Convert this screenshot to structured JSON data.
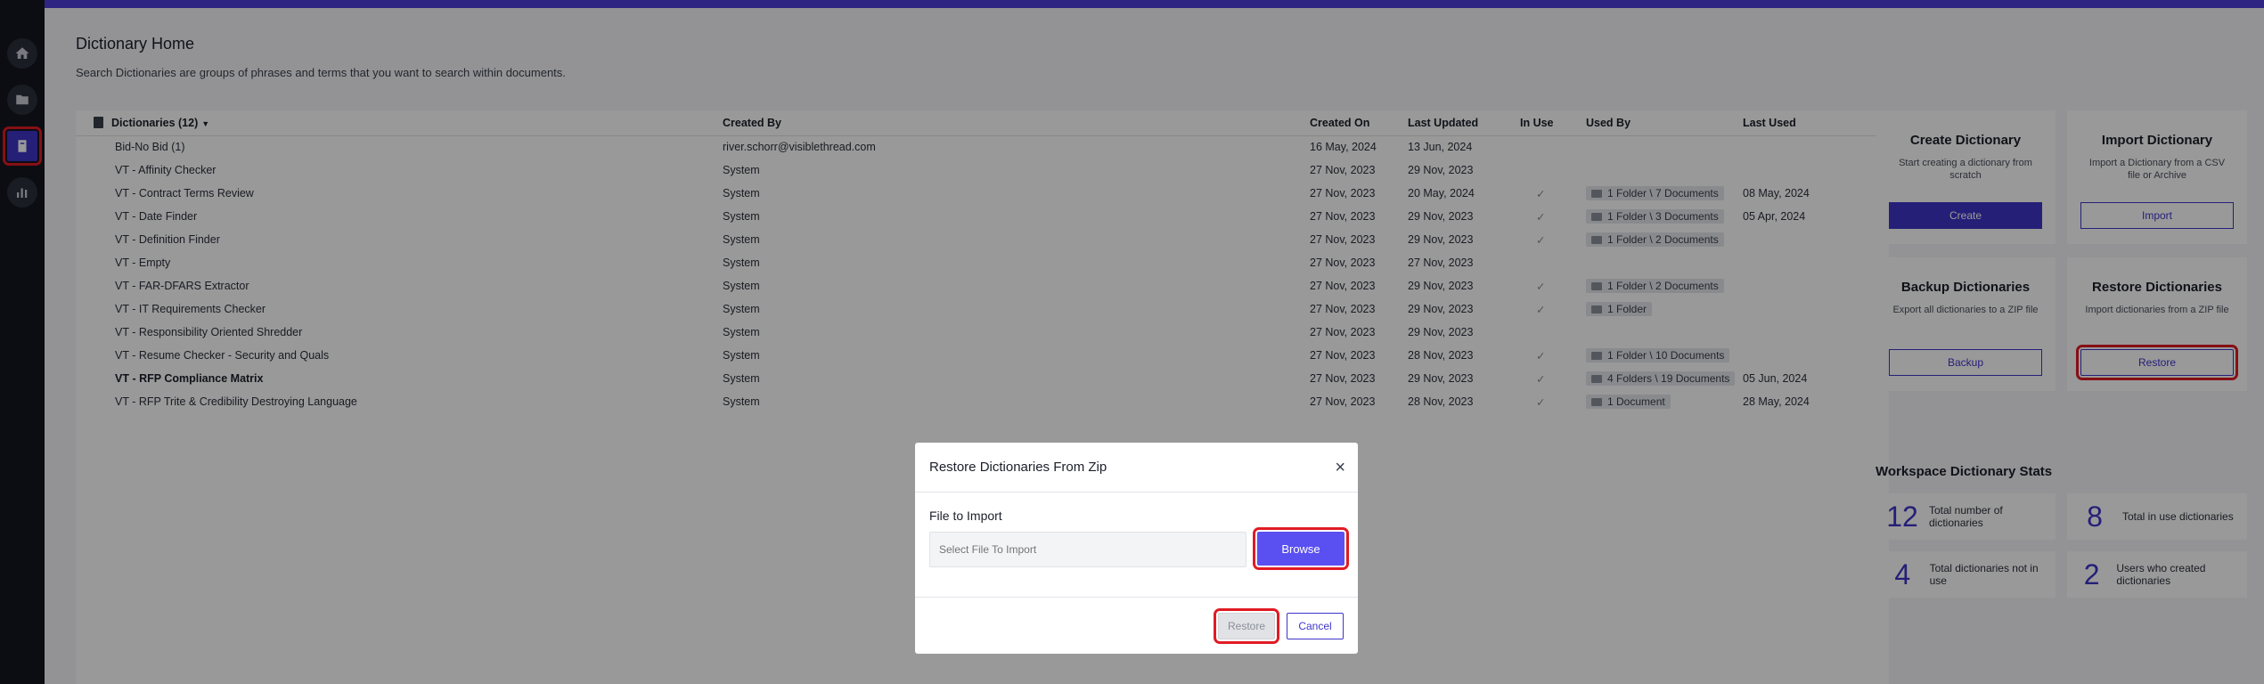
{
  "header": {
    "title": "Dictionary Home",
    "description": "Search Dictionaries are groups of phrases and terms that you want to search within documents."
  },
  "sidebar": {
    "items": [
      {
        "icon": "home-icon"
      },
      {
        "icon": "folder-icon"
      },
      {
        "icon": "dictionary-icon",
        "active": true
      },
      {
        "icon": "chart-icon"
      }
    ]
  },
  "table": {
    "columns": [
      "Dictionaries (12)",
      "Created By",
      "Created On",
      "Last Updated",
      "In Use",
      "Used By",
      "Last Used"
    ],
    "rows": [
      {
        "name": "Bid-No Bid (1)",
        "created_by": "river.schorr@visiblethread.com",
        "created_on": "16 May, 2024",
        "last_updated": "13 Jun, 2024",
        "in_use": "",
        "used_by": "",
        "last_used": ""
      },
      {
        "name": "VT - Affinity Checker",
        "created_by": "System",
        "created_on": "27 Nov, 2023",
        "last_updated": "29 Nov, 2023",
        "in_use": "",
        "used_by": "",
        "last_used": ""
      },
      {
        "name": "VT - Contract Terms Review",
        "created_by": "System",
        "created_on": "27 Nov, 2023",
        "last_updated": "20 May, 2024",
        "in_use": "✓",
        "used_by": "1 Folder \\ 7 Documents",
        "last_used": "08 May, 2024"
      },
      {
        "name": "VT - Date Finder",
        "created_by": "System",
        "created_on": "27 Nov, 2023",
        "last_updated": "29 Nov, 2023",
        "in_use": "✓",
        "used_by": "1 Folder \\ 3 Documents",
        "last_used": "05 Apr, 2024"
      },
      {
        "name": "VT - Definition Finder",
        "created_by": "System",
        "created_on": "27 Nov, 2023",
        "last_updated": "29 Nov, 2023",
        "in_use": "✓",
        "used_by": "1 Folder \\ 2 Documents",
        "last_used": ""
      },
      {
        "name": "VT - Empty",
        "created_by": "System",
        "created_on": "27 Nov, 2023",
        "last_updated": "27 Nov, 2023",
        "in_use": "",
        "used_by": "",
        "last_used": ""
      },
      {
        "name": "VT - FAR-DFARS Extractor",
        "created_by": "System",
        "created_on": "27 Nov, 2023",
        "last_updated": "29 Nov, 2023",
        "in_use": "✓",
        "used_by": "1 Folder \\ 2 Documents",
        "last_used": ""
      },
      {
        "name": "VT - IT Requirements Checker",
        "created_by": "System",
        "created_on": "27 Nov, 2023",
        "last_updated": "29 Nov, 2023",
        "in_use": "✓",
        "used_by": "1 Folder",
        "last_used": ""
      },
      {
        "name": "VT - Responsibility Oriented Shredder",
        "created_by": "System",
        "created_on": "27 Nov, 2023",
        "last_updated": "29 Nov, 2023",
        "in_use": "",
        "used_by": "",
        "last_used": ""
      },
      {
        "name": "VT - Resume Checker - Security and Quals",
        "created_by": "System",
        "created_on": "27 Nov, 2023",
        "last_updated": "28 Nov, 2023",
        "in_use": "✓",
        "used_by": "1 Folder \\ 10 Documents",
        "last_used": ""
      },
      {
        "name": "VT - RFP Compliance Matrix",
        "created_by": "System",
        "created_on": "27 Nov, 2023",
        "last_updated": "29 Nov, 2023",
        "in_use": "✓",
        "used_by": "4 Folders \\ 19 Documents",
        "last_used": "05 Jun, 2024",
        "bold": true
      },
      {
        "name": "VT - RFP Trite & Credibility Destroying Language",
        "created_by": "System",
        "created_on": "27 Nov, 2023",
        "last_updated": "28 Nov, 2023",
        "in_use": "✓",
        "used_by": "1 Document",
        "last_used": "28 May, 2024"
      }
    ]
  },
  "actions": {
    "create": {
      "title": "Create Dictionary",
      "desc": "Start creating a dictionary from scratch",
      "button": "Create"
    },
    "import": {
      "title": "Import Dictionary",
      "desc": "Import a Dictionary from a CSV file or Archive",
      "button": "Import"
    },
    "backup": {
      "title": "Backup Dictionaries",
      "desc": "Export all dictionaries to a ZIP file",
      "button": "Backup"
    },
    "restore": {
      "title": "Restore Dictionaries",
      "desc": "Import dictionaries from a ZIP file",
      "button": "Restore"
    }
  },
  "stats": {
    "title": "Workspace Dictionary Stats",
    "items": [
      {
        "value": "12",
        "label": "Total number of dictionaries"
      },
      {
        "value": "8",
        "label": "Total in use dictionaries"
      },
      {
        "value": "4",
        "label": "Total dictionaries not in use"
      },
      {
        "value": "2",
        "label": "Users who created dictionaries"
      }
    ]
  },
  "modal": {
    "title": "Restore Dictionaries From Zip",
    "close": "×",
    "field_label": "File to Import",
    "placeholder": "Select File To Import",
    "browse": "Browse",
    "restore": "Restore",
    "cancel": "Cancel"
  },
  "colors": {
    "accent": "#3f35c9",
    "highlight": "#e01b24",
    "sidebar": "#14171f"
  }
}
